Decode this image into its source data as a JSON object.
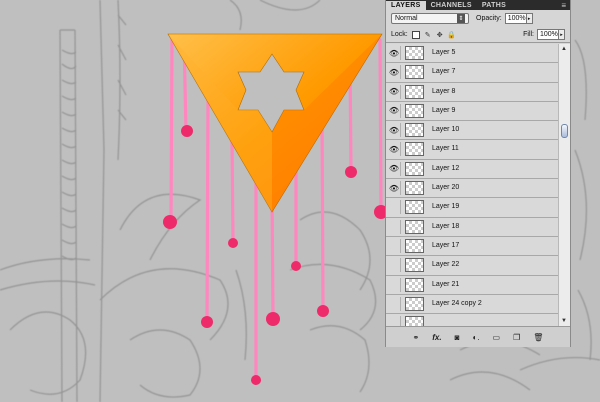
{
  "panel": {
    "tabs": [
      "LAYERS",
      "CHANNELS",
      "PATHS"
    ],
    "active_tab": "LAYERS",
    "blend_mode": "Normal",
    "opacity_label": "Opacity:",
    "opacity_value": "100%",
    "lock_label": "Lock:",
    "fill_label": "Fill:",
    "fill_value": "100%",
    "layers": [
      {
        "name": "Layer 5",
        "visible": true
      },
      {
        "name": "Layer 7",
        "visible": true
      },
      {
        "name": "Layer 8",
        "visible": true
      },
      {
        "name": "Layer 9",
        "visible": true
      },
      {
        "name": "Layer 10",
        "visible": true
      },
      {
        "name": "Layer 11",
        "visible": true
      },
      {
        "name": "Layer 12",
        "visible": true
      },
      {
        "name": "Layer 20",
        "visible": true
      },
      {
        "name": "Layer 19",
        "visible": false
      },
      {
        "name": "Layer 18",
        "visible": false
      },
      {
        "name": "Layer 17",
        "visible": false
      },
      {
        "name": "Layer 22",
        "visible": false
      },
      {
        "name": "Layer 21",
        "visible": false
      },
      {
        "name": "Layer 24 copy 2",
        "visible": false
      },
      {
        "name": "",
        "visible": false
      }
    ],
    "bottom_icons": [
      "link-icon",
      "fx-icon",
      "mask-icon",
      "adjustment-icon",
      "folder-icon",
      "new-layer-icon",
      "trash-icon"
    ]
  },
  "colors": {
    "triangle_orange": "#ff9a00",
    "drip_pink": "#ff7ab8",
    "drop_red": "#ee2a6a",
    "sketch_gray": "#bcbcbc"
  }
}
